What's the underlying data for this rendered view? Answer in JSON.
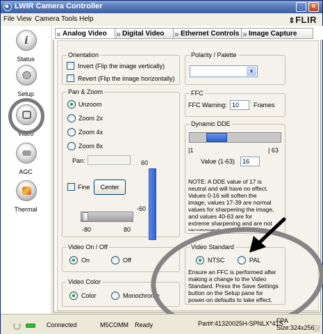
{
  "window": {
    "title": "LWIR Camera Controller"
  },
  "menu": [
    "File",
    "View",
    "Camera",
    "Tools",
    "Help"
  ],
  "logo": "FLIR",
  "sidebar": {
    "items": [
      {
        "label": "Status",
        "icon": "info-icon"
      },
      {
        "label": "Setup",
        "icon": "gear-icon"
      },
      {
        "label": "Video",
        "icon": "monitor-icon"
      },
      {
        "label": "AGC",
        "icon": "agc-icon"
      },
      {
        "label": "Thermal",
        "icon": "thermal-icon"
      }
    ]
  },
  "tabs": [
    {
      "label": "Analog Video",
      "active": true
    },
    {
      "label": "Digital Video",
      "active": false
    },
    {
      "label": "Ethernet Controls",
      "active": false
    },
    {
      "label": "Image Capture",
      "active": false
    }
  ],
  "orientation": {
    "legend": "Orientation",
    "invert_label": "Invert (Flip the image vertically)",
    "revert_label": "Revert (Flip the image horizontally)"
  },
  "polarity": {
    "legend": "Polarity / Palette",
    "value": ""
  },
  "pan_zoom": {
    "legend": "Pan & Zoom",
    "options": [
      "Unzoom",
      "Zoom 2x",
      "Zoom 4x",
      "Zoom 8x"
    ],
    "selected": "Unzoom",
    "pan_label": "Pan:",
    "fine_label": "Fine",
    "center_button": "Center",
    "v_max": "60",
    "v_min": "-60",
    "h_min": "-80",
    "h_max": "80"
  },
  "ffc": {
    "legend": "FFC",
    "warning_label": "FFC Warning:",
    "warning_value": "10",
    "unit": "Frames"
  },
  "dde": {
    "legend": "Dynamic DDE",
    "min": "|1",
    "max": "| 63",
    "value_label": "Value (1-63)",
    "value": "16",
    "level_fraction": 0.24,
    "note_lines": [
      "NOTE: A DDE value of 17 is",
      "neutral and will have no effect.",
      "Values 0-16 will soften the",
      "image, values 17-39 are normal",
      "values for sharpening the image,",
      "and values 40-63 are for",
      "extreme sharpening and are not",
      "recommended."
    ]
  },
  "video_onoff": {
    "legend": "Video On / Off",
    "on_label": "On",
    "off_label": "Off",
    "selected": "On"
  },
  "video_standard": {
    "legend": "Video Standard",
    "ntsc_label": "NTSC",
    "pal_label": "PAL",
    "selected": "NTSC",
    "note_lines": [
      "Ensure an FFC is performed after",
      "making a change to the Video",
      "Standard. Press the Save Settings",
      "button on the Setup pane  for",
      "power-on defaults to take effect."
    ]
  },
  "video_color": {
    "legend": "Video Color",
    "color_label": "Color",
    "mono_label": "Monochrome",
    "selected": "Color"
  },
  "status": {
    "connection": "Connected",
    "port": "M5COMM",
    "state": "Ready",
    "part": "Part#:41320025H-SPNLX*41S",
    "fpa_line1": "FPA",
    "fpa_line2": "Size:324x256"
  },
  "colors": {
    "accent": "#2f5fd0",
    "annotation": "#858585",
    "titlebar": "#4f70b0"
  }
}
